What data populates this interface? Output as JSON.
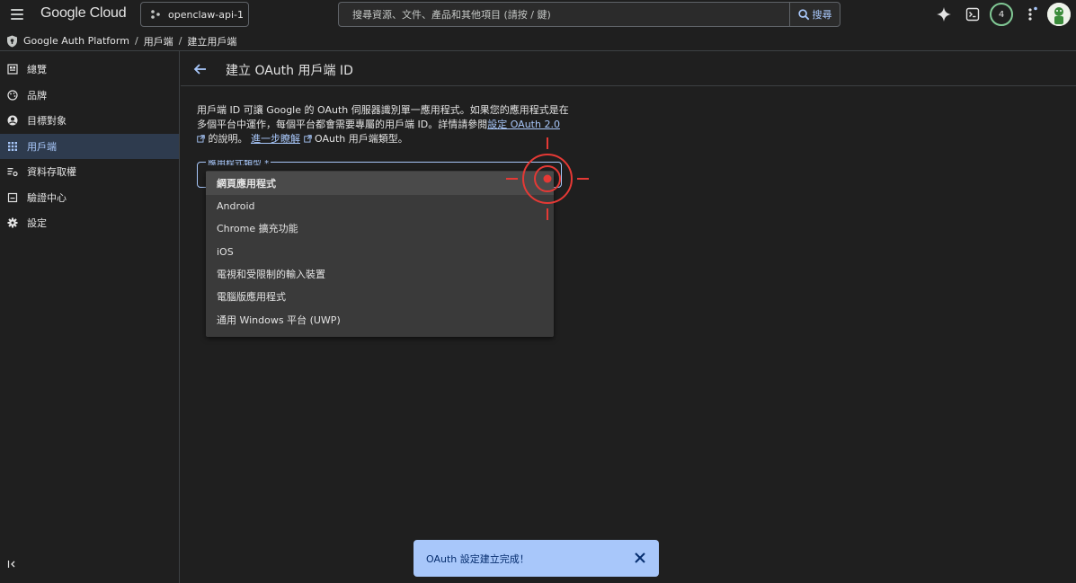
{
  "topbar": {
    "logo": "Google Cloud",
    "project": "openclaw-api-1",
    "search_placeholder": "搜尋資源、文件、產品和其他項目 (請按 / 鍵)",
    "search_button": "搜尋",
    "notification_count": "4"
  },
  "breadcrumb": {
    "items": [
      "Google Auth Platform",
      "用戶端",
      "建立用戶端"
    ],
    "separator": "/"
  },
  "sidebar": {
    "items": [
      {
        "label": "總覽",
        "icon": "dashboard-icon"
      },
      {
        "label": "品牌",
        "icon": "palette-icon"
      },
      {
        "label": "目標對象",
        "icon": "account-circle-icon"
      },
      {
        "label": "用戶端",
        "icon": "apps-grid-icon",
        "active": true
      },
      {
        "label": "資料存取權",
        "icon": "data-access-icon"
      },
      {
        "label": "驗證中心",
        "icon": "verification-icon"
      },
      {
        "label": "設定",
        "icon": "gear-icon"
      }
    ]
  },
  "page": {
    "title": "建立 OAuth 用戶端 ID",
    "desc_line1": "用戶端 ID 可讓 Google 的 OAuth 伺服器識別單一應用程式。如果您的應用程式是在",
    "desc_line2_prefix": "多個平台中運作，每個平台都會需要專屬的用戶端 ID。詳情請參閱",
    "desc_link1": "設定 OAuth 2.0",
    "desc_line3_mid": "的說明。",
    "desc_link2": "進一步瞭解",
    "desc_line3_suffix": "OAuth 用戶端類型。",
    "select_label": "應用程式類型 *"
  },
  "dropdown": {
    "options": [
      {
        "label": "網頁應用程式",
        "selected": true
      },
      {
        "label": "Android"
      },
      {
        "label": "Chrome 擴充功能"
      },
      {
        "label": "iOS"
      },
      {
        "label": "電視和受限制的輸入裝置"
      },
      {
        "label": "電腦版應用程式"
      },
      {
        "label": "通用 Windows 平台 (UWP)"
      }
    ]
  },
  "snackbar": {
    "message": "OAuth 設定建立完成！"
  },
  "colors": {
    "accent": "#a8c7fa",
    "background": "#1f1f1f",
    "crosshair": "#e53935",
    "snackbar_bg": "#a8c7fa"
  }
}
